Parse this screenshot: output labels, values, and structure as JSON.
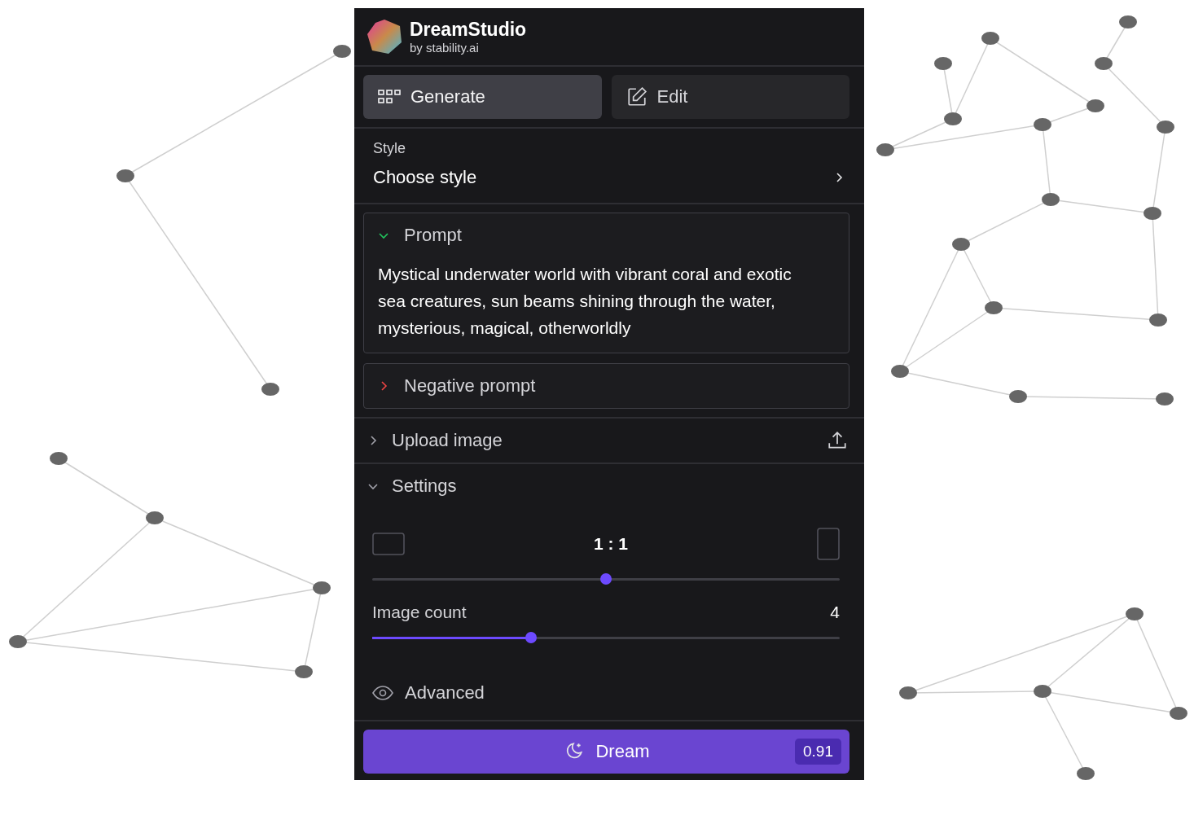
{
  "brand": {
    "name": "DreamStudio",
    "byline": "by stability.ai"
  },
  "tabs": [
    {
      "label": "Generate",
      "selected": true
    },
    {
      "label": "Edit",
      "selected": false
    }
  ],
  "style": {
    "label": "Style",
    "value": "Choose style"
  },
  "prompts": [
    {
      "title": "Prompt",
      "expanded": true,
      "color": "#22c55e",
      "text": "Mystical underwater world with vibrant coral and exotic sea creatures, sun beams shining through the water, mysterious, magical, otherworldly"
    },
    {
      "title": "Negative prompt",
      "expanded": false,
      "color": "#ef4444"
    }
  ],
  "upload": {
    "title": "Upload image",
    "expanded": false
  },
  "settings": {
    "title": "Settings",
    "expanded": true,
    "aspect": {
      "value": "1 : 1",
      "level": 0.5
    },
    "image_count": {
      "label": "Image count",
      "value": "4",
      "level": 0.34
    },
    "advanced": {
      "label": "Advanced"
    }
  },
  "dream": {
    "label": "Dream",
    "cost": "0.91"
  }
}
